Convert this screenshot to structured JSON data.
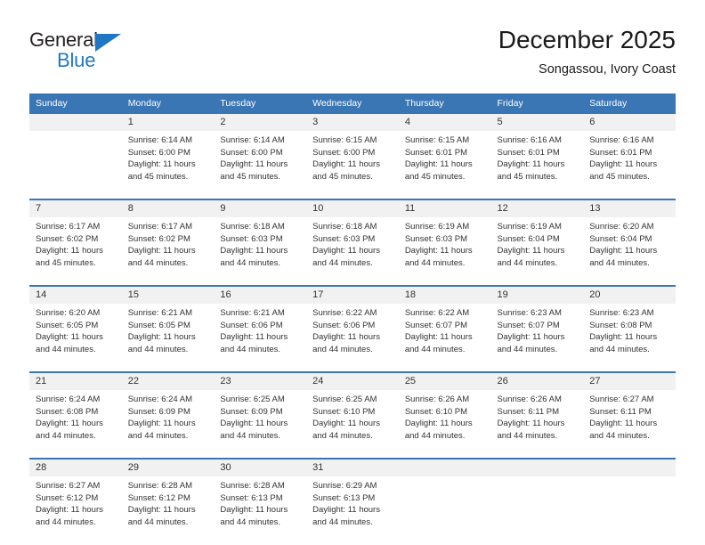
{
  "brand": {
    "name_top": "General",
    "name_bottom": "Blue",
    "triangle_color": "#1f77c4",
    "text_color": "#231f20"
  },
  "header": {
    "title": "December 2025",
    "subtitle": "Songassou, Ivory Coast"
  },
  "colors": {
    "header_bar": "#3b76b4",
    "header_text": "#ffffff",
    "daynum_band": "#f1f1f1",
    "body_text": "#333333",
    "separator": "#3b76b4"
  },
  "weekday_headers": [
    "Sunday",
    "Monday",
    "Tuesday",
    "Wednesday",
    "Thursday",
    "Friday",
    "Saturday"
  ],
  "labels": {
    "sunrise_prefix": "Sunrise:",
    "sunset_prefix": "Sunset:",
    "daylight_prefix": "Daylight:"
  },
  "weeks": [
    {
      "days": [
        {
          "num": "",
          "sunrise": "",
          "sunset": "",
          "daylight_line1": "",
          "daylight_line2": ""
        },
        {
          "num": "1",
          "sunrise": "Sunrise: 6:14 AM",
          "sunset": "Sunset: 6:00 PM",
          "daylight_line1": "Daylight: 11 hours",
          "daylight_line2": "and 45 minutes."
        },
        {
          "num": "2",
          "sunrise": "Sunrise: 6:14 AM",
          "sunset": "Sunset: 6:00 PM",
          "daylight_line1": "Daylight: 11 hours",
          "daylight_line2": "and 45 minutes."
        },
        {
          "num": "3",
          "sunrise": "Sunrise: 6:15 AM",
          "sunset": "Sunset: 6:00 PM",
          "daylight_line1": "Daylight: 11 hours",
          "daylight_line2": "and 45 minutes."
        },
        {
          "num": "4",
          "sunrise": "Sunrise: 6:15 AM",
          "sunset": "Sunset: 6:01 PM",
          "daylight_line1": "Daylight: 11 hours",
          "daylight_line2": "and 45 minutes."
        },
        {
          "num": "5",
          "sunrise": "Sunrise: 6:16 AM",
          "sunset": "Sunset: 6:01 PM",
          "daylight_line1": "Daylight: 11 hours",
          "daylight_line2": "and 45 minutes."
        },
        {
          "num": "6",
          "sunrise": "Sunrise: 6:16 AM",
          "sunset": "Sunset: 6:01 PM",
          "daylight_line1": "Daylight: 11 hours",
          "daylight_line2": "and 45 minutes."
        }
      ]
    },
    {
      "days": [
        {
          "num": "7",
          "sunrise": "Sunrise: 6:17 AM",
          "sunset": "Sunset: 6:02 PM",
          "daylight_line1": "Daylight: 11 hours",
          "daylight_line2": "and 45 minutes."
        },
        {
          "num": "8",
          "sunrise": "Sunrise: 6:17 AM",
          "sunset": "Sunset: 6:02 PM",
          "daylight_line1": "Daylight: 11 hours",
          "daylight_line2": "and 44 minutes."
        },
        {
          "num": "9",
          "sunrise": "Sunrise: 6:18 AM",
          "sunset": "Sunset: 6:03 PM",
          "daylight_line1": "Daylight: 11 hours",
          "daylight_line2": "and 44 minutes."
        },
        {
          "num": "10",
          "sunrise": "Sunrise: 6:18 AM",
          "sunset": "Sunset: 6:03 PM",
          "daylight_line1": "Daylight: 11 hours",
          "daylight_line2": "and 44 minutes."
        },
        {
          "num": "11",
          "sunrise": "Sunrise: 6:19 AM",
          "sunset": "Sunset: 6:03 PM",
          "daylight_line1": "Daylight: 11 hours",
          "daylight_line2": "and 44 minutes."
        },
        {
          "num": "12",
          "sunrise": "Sunrise: 6:19 AM",
          "sunset": "Sunset: 6:04 PM",
          "daylight_line1": "Daylight: 11 hours",
          "daylight_line2": "and 44 minutes."
        },
        {
          "num": "13",
          "sunrise": "Sunrise: 6:20 AM",
          "sunset": "Sunset: 6:04 PM",
          "daylight_line1": "Daylight: 11 hours",
          "daylight_line2": "and 44 minutes."
        }
      ]
    },
    {
      "days": [
        {
          "num": "14",
          "sunrise": "Sunrise: 6:20 AM",
          "sunset": "Sunset: 6:05 PM",
          "daylight_line1": "Daylight: 11 hours",
          "daylight_line2": "and 44 minutes."
        },
        {
          "num": "15",
          "sunrise": "Sunrise: 6:21 AM",
          "sunset": "Sunset: 6:05 PM",
          "daylight_line1": "Daylight: 11 hours",
          "daylight_line2": "and 44 minutes."
        },
        {
          "num": "16",
          "sunrise": "Sunrise: 6:21 AM",
          "sunset": "Sunset: 6:06 PM",
          "daylight_line1": "Daylight: 11 hours",
          "daylight_line2": "and 44 minutes."
        },
        {
          "num": "17",
          "sunrise": "Sunrise: 6:22 AM",
          "sunset": "Sunset: 6:06 PM",
          "daylight_line1": "Daylight: 11 hours",
          "daylight_line2": "and 44 minutes."
        },
        {
          "num": "18",
          "sunrise": "Sunrise: 6:22 AM",
          "sunset": "Sunset: 6:07 PM",
          "daylight_line1": "Daylight: 11 hours",
          "daylight_line2": "and 44 minutes."
        },
        {
          "num": "19",
          "sunrise": "Sunrise: 6:23 AM",
          "sunset": "Sunset: 6:07 PM",
          "daylight_line1": "Daylight: 11 hours",
          "daylight_line2": "and 44 minutes."
        },
        {
          "num": "20",
          "sunrise": "Sunrise: 6:23 AM",
          "sunset": "Sunset: 6:08 PM",
          "daylight_line1": "Daylight: 11 hours",
          "daylight_line2": "and 44 minutes."
        }
      ]
    },
    {
      "days": [
        {
          "num": "21",
          "sunrise": "Sunrise: 6:24 AM",
          "sunset": "Sunset: 6:08 PM",
          "daylight_line1": "Daylight: 11 hours",
          "daylight_line2": "and 44 minutes."
        },
        {
          "num": "22",
          "sunrise": "Sunrise: 6:24 AM",
          "sunset": "Sunset: 6:09 PM",
          "daylight_line1": "Daylight: 11 hours",
          "daylight_line2": "and 44 minutes."
        },
        {
          "num": "23",
          "sunrise": "Sunrise: 6:25 AM",
          "sunset": "Sunset: 6:09 PM",
          "daylight_line1": "Daylight: 11 hours",
          "daylight_line2": "and 44 minutes."
        },
        {
          "num": "24",
          "sunrise": "Sunrise: 6:25 AM",
          "sunset": "Sunset: 6:10 PM",
          "daylight_line1": "Daylight: 11 hours",
          "daylight_line2": "and 44 minutes."
        },
        {
          "num": "25",
          "sunrise": "Sunrise: 6:26 AM",
          "sunset": "Sunset: 6:10 PM",
          "daylight_line1": "Daylight: 11 hours",
          "daylight_line2": "and 44 minutes."
        },
        {
          "num": "26",
          "sunrise": "Sunrise: 6:26 AM",
          "sunset": "Sunset: 6:11 PM",
          "daylight_line1": "Daylight: 11 hours",
          "daylight_line2": "and 44 minutes."
        },
        {
          "num": "27",
          "sunrise": "Sunrise: 6:27 AM",
          "sunset": "Sunset: 6:11 PM",
          "daylight_line1": "Daylight: 11 hours",
          "daylight_line2": "and 44 minutes."
        }
      ]
    },
    {
      "days": [
        {
          "num": "28",
          "sunrise": "Sunrise: 6:27 AM",
          "sunset": "Sunset: 6:12 PM",
          "daylight_line1": "Daylight: 11 hours",
          "daylight_line2": "and 44 minutes."
        },
        {
          "num": "29",
          "sunrise": "Sunrise: 6:28 AM",
          "sunset": "Sunset: 6:12 PM",
          "daylight_line1": "Daylight: 11 hours",
          "daylight_line2": "and 44 minutes."
        },
        {
          "num": "30",
          "sunrise": "Sunrise: 6:28 AM",
          "sunset": "Sunset: 6:13 PM",
          "daylight_line1": "Daylight: 11 hours",
          "daylight_line2": "and 44 minutes."
        },
        {
          "num": "31",
          "sunrise": "Sunrise: 6:29 AM",
          "sunset": "Sunset: 6:13 PM",
          "daylight_line1": "Daylight: 11 hours",
          "daylight_line2": "and 44 minutes."
        },
        {
          "num": "",
          "sunrise": "",
          "sunset": "",
          "daylight_line1": "",
          "daylight_line2": ""
        },
        {
          "num": "",
          "sunrise": "",
          "sunset": "",
          "daylight_line1": "",
          "daylight_line2": ""
        },
        {
          "num": "",
          "sunrise": "",
          "sunset": "",
          "daylight_line1": "",
          "daylight_line2": ""
        }
      ]
    }
  ]
}
